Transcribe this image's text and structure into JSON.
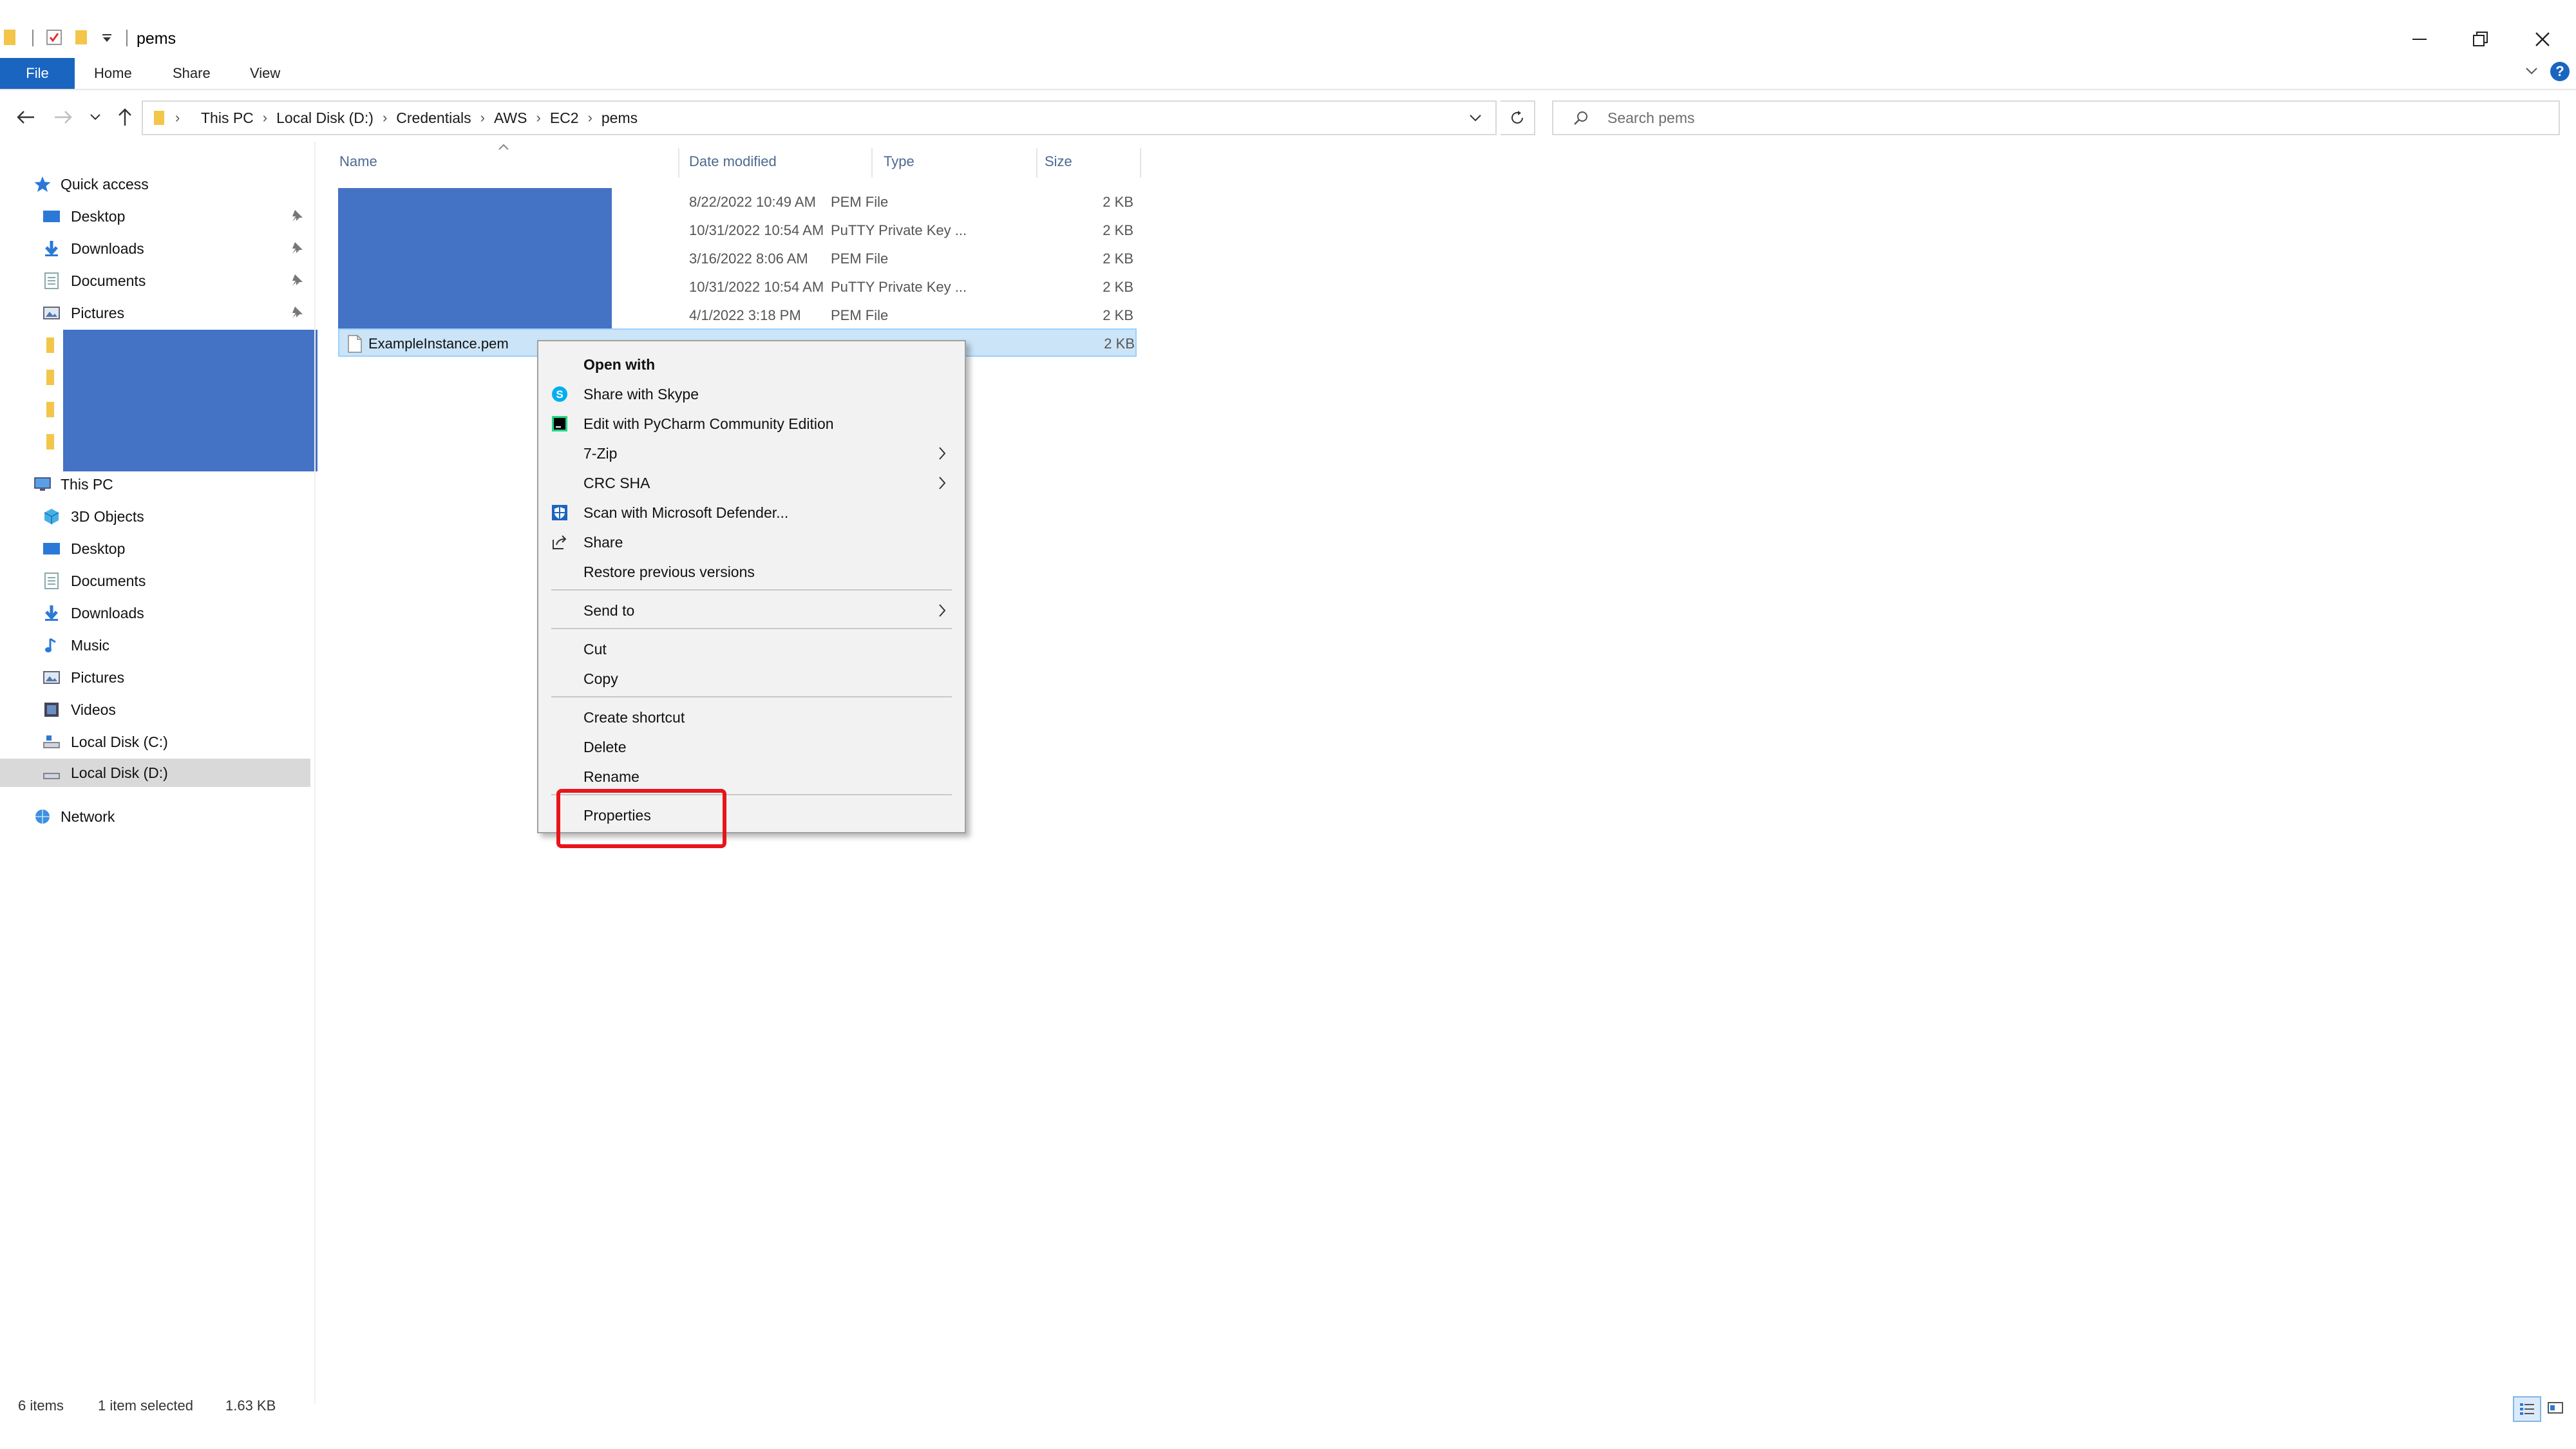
{
  "window": {
    "title": "pems",
    "minimize_glyph": "–",
    "close_glyph": "✕"
  },
  "ribbon": {
    "tabs": [
      {
        "label": "File",
        "active": true
      },
      {
        "label": "Home"
      },
      {
        "label": "Share"
      },
      {
        "label": "View"
      }
    ],
    "accent_color": "#1a65c0"
  },
  "address_bar": {
    "breadcrumbs": [
      "This PC",
      "Local Disk (D:)",
      "Credentials",
      "AWS",
      "EC2",
      "pems"
    ]
  },
  "search": {
    "placeholder": "Search pems"
  },
  "nav_pane": {
    "quick_access": {
      "label": "Quick access",
      "items": [
        {
          "label": "Desktop",
          "icon": "desktop-icon",
          "pinned": true
        },
        {
          "label": "Downloads",
          "icon": "downloads-icon",
          "pinned": true
        },
        {
          "label": "Documents",
          "icon": "documents-icon",
          "pinned": true
        },
        {
          "label": "Pictures",
          "icon": "pictures-icon",
          "pinned": true
        }
      ]
    },
    "this_pc": {
      "label": "This PC",
      "items": [
        {
          "label": "3D Objects",
          "icon": "3d-objects-icon"
        },
        {
          "label": "Desktop",
          "icon": "desktop-icon"
        },
        {
          "label": "Documents",
          "icon": "documents-icon"
        },
        {
          "label": "Downloads",
          "icon": "downloads-icon"
        },
        {
          "label": "Music",
          "icon": "music-icon"
        },
        {
          "label": "Pictures",
          "icon": "pictures-icon"
        },
        {
          "label": "Videos",
          "icon": "videos-icon"
        },
        {
          "label": "Local Disk (C:)",
          "icon": "drive-icon"
        },
        {
          "label": "Local Disk (D:)",
          "icon": "drive-icon",
          "selected": true
        }
      ]
    },
    "network": {
      "label": "Network"
    }
  },
  "file_list": {
    "columns": [
      "Name",
      "Date modified",
      "Type",
      "Size"
    ],
    "rows": [
      {
        "date": "8/22/2022 10:49 AM",
        "type": "PEM File",
        "size": "2 KB"
      },
      {
        "date": "10/31/2022 10:54 AM",
        "type": "PuTTY Private Key ...",
        "size": "2 KB"
      },
      {
        "date": "3/16/2022 8:06 AM",
        "type": "PEM File",
        "size": "2 KB"
      },
      {
        "date": "10/31/2022 10:54 AM",
        "type": "PuTTY Private Key ...",
        "size": "2 KB"
      },
      {
        "date": "4/1/2022 3:18 PM",
        "type": "PEM File",
        "size": "2 KB"
      }
    ],
    "selected_row": {
      "name": "ExampleInstance.pem",
      "size": "2 KB"
    }
  },
  "context_menu": {
    "items": [
      {
        "label": "Open with",
        "bold": true
      },
      {
        "label": "Share with Skype",
        "icon": "skype-icon"
      },
      {
        "label": "Edit with PyCharm Community Edition",
        "icon": "pycharm-icon"
      },
      {
        "label": "7-Zip",
        "submenu": true
      },
      {
        "label": "CRC SHA",
        "submenu": true
      },
      {
        "label": "Scan with Microsoft Defender...",
        "icon": "defender-icon"
      },
      {
        "label": "Share",
        "icon": "share-icon"
      },
      {
        "label": "Restore previous versions"
      },
      {
        "label": "Send to",
        "submenu": true
      },
      {
        "label": "Cut"
      },
      {
        "label": "Copy"
      },
      {
        "label": "Create shortcut"
      },
      {
        "label": "Delete"
      },
      {
        "label": "Rename"
      },
      {
        "label": "Properties",
        "highlighted": true
      }
    ],
    "highlight_color": "#e8141a"
  },
  "status_bar": {
    "item_count": "6 items",
    "selection": "1 item selected",
    "size": "1.63 KB"
  },
  "redaction_color": "#4472c4"
}
